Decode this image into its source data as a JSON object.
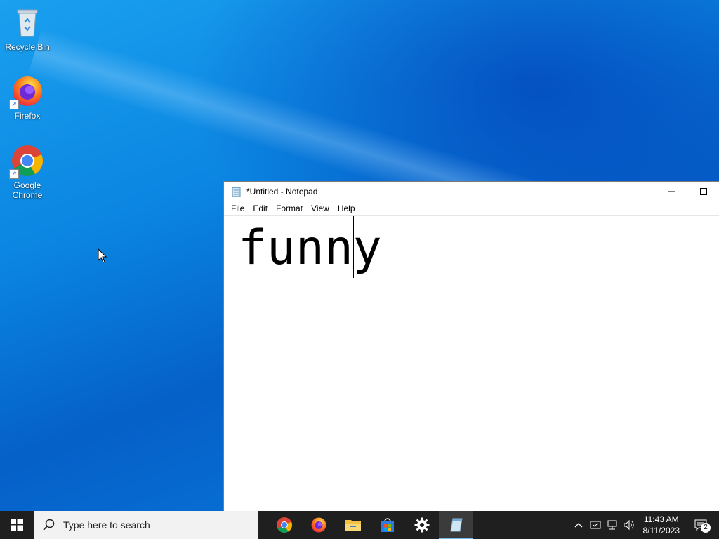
{
  "desktop": {
    "icons": [
      {
        "label": "Recycle Bin",
        "icon": "recycle-bin-icon"
      },
      {
        "label": "Firefox",
        "icon": "firefox-icon"
      },
      {
        "label": "Google Chrome",
        "icon": "chrome-icon"
      }
    ]
  },
  "notepad": {
    "title": "*Untitled - Notepad",
    "menu": [
      "File",
      "Edit",
      "Format",
      "View",
      "Help"
    ],
    "content": "funny",
    "controls": {
      "minimize": "—",
      "maximize": "□"
    }
  },
  "taskbar": {
    "search_placeholder": "Type here to search",
    "apps": [
      "chrome-icon",
      "firefox-icon",
      "file-explorer-icon",
      "store-icon",
      "settings-icon",
      "notepad-icon"
    ],
    "clock_time": "11:43 AM",
    "clock_date": "8/11/2023",
    "notification_count": "2"
  },
  "colors": {
    "taskbar": "#1f1f1f",
    "accent": "#76b9ed",
    "desktop": "#0a78d8"
  }
}
